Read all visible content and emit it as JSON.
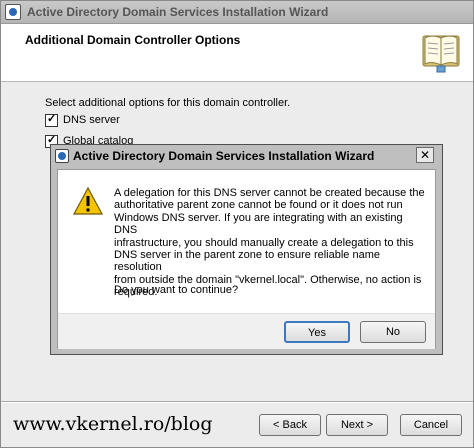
{
  "wizard": {
    "title": "Active Directory Domain Services Installation Wizard",
    "header": "Additional Domain Controller Options",
    "instruction": "Select additional options for this domain controller.",
    "options": [
      {
        "label": "DNS server",
        "checked": true
      },
      {
        "label": "Global catalog",
        "checked": true
      }
    ],
    "buttons": {
      "back": "< Back",
      "next": "Next >",
      "cancel": "Cancel"
    },
    "watermark": "www.vkernel.ro/blog"
  },
  "dialog": {
    "title": "Active Directory Domain Services Installation Wizard",
    "close_glyph": "✕",
    "message_lines": [
      "A delegation for this DNS server cannot be created because the",
      "authoritative parent zone cannot be found or it does not run",
      "Windows DNS server. If you are integrating with an existing DNS",
      "infrastructure, you should manually create a delegation to this",
      "DNS server in the parent zone to ensure reliable name resolution",
      "from outside the domain \"vkernel.local\". Otherwise, no action is",
      "required."
    ],
    "question": "Do you want to continue?",
    "buttons": {
      "yes": "Yes",
      "no": "No"
    }
  },
  "icons": {
    "app": "app-icon",
    "book": "book-icon",
    "warning": "warning-icon",
    "close": "close-icon"
  },
  "colors": {
    "accent": "#2a67b8",
    "warning": "#f5c400"
  }
}
